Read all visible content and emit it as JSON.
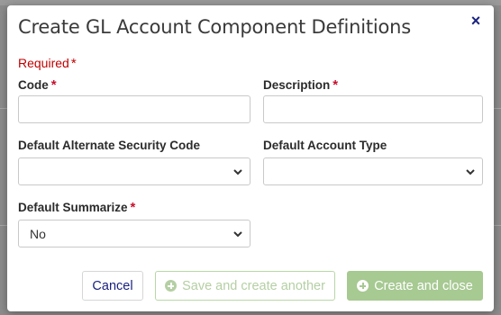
{
  "dialog": {
    "title": "Create GL Account Component Definitions",
    "close_symbol": "×",
    "required_note": "Required",
    "required_star": "*"
  },
  "fields": {
    "code": {
      "label": "Code",
      "value": ""
    },
    "description": {
      "label": "Description",
      "value": ""
    },
    "default_alternate_security_code": {
      "label": "Default Alternate Security Code",
      "selected": ""
    },
    "default_account_type": {
      "label": "Default Account Type",
      "selected": ""
    },
    "default_summarize": {
      "label": "Default Summarize",
      "selected": "No"
    }
  },
  "buttons": {
    "cancel": "Cancel",
    "save_and_create_another": "Save and create another",
    "create_and_close": "Create and close"
  },
  "colors": {
    "accent_navy": "#1a237e",
    "required_red": "#c8102e",
    "primary_green": "#a7c992"
  },
  "icons": {
    "close": "close-icon",
    "plus_circle": "plus-circle-icon",
    "chevron": "chevron-down-icon"
  }
}
